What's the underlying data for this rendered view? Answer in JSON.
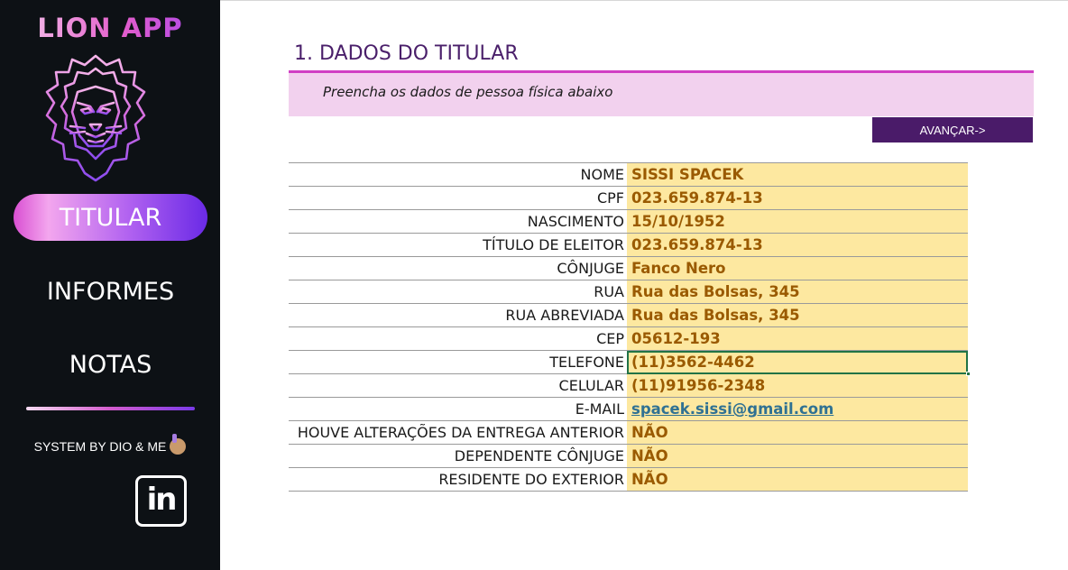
{
  "sidebar": {
    "app_title": "LION APP",
    "logo_icon": "lion-head-icon",
    "nav": [
      {
        "label": "TITULAR",
        "active": true
      },
      {
        "label": "INFORMES",
        "active": false
      },
      {
        "label": "NOTAS",
        "active": false
      }
    ],
    "credit": "SYSTEM BY DIO & ME",
    "credit_emoji": "person-raising-hand-icon",
    "social_icon": "linkedin-icon",
    "social_text": "in"
  },
  "main": {
    "section_title": "1. DADOS DO TITULAR",
    "instruction": "Preencha os dados de pessoa física abaixo",
    "advance_button": "AVANÇAR->",
    "fields": [
      {
        "label": "NOME",
        "value": "SISSI SPACEK"
      },
      {
        "label": "CPF",
        "value": "023.659.874-13"
      },
      {
        "label": "NASCIMENTO",
        "value": "15/10/1952"
      },
      {
        "label": "TÍTULO DE ELEITOR",
        "value": "023.659.874-13"
      },
      {
        "label": "CÔNJUGE",
        "value": "Fanco Nero"
      },
      {
        "label": "RUA",
        "value": "Rua das Bolsas, 345"
      },
      {
        "label": "RUA ABREVIADA",
        "value": "Rua das Bolsas, 345"
      },
      {
        "label": "CEP",
        "value": "05612-193"
      },
      {
        "label": "TELEFONE",
        "value": "(11)3562-4462"
      },
      {
        "label": "CELULAR",
        "value": "(11)91956-2348"
      },
      {
        "label": "E-MAIL",
        "value": "spacek.sissi@gmail.com"
      },
      {
        "label": "HOUVE ALTERAÇÕES DA ENTREGA ANTERIOR",
        "value": "NÃO"
      },
      {
        "label": "DEPENDENTE CÔNJUGE",
        "value": "NÃO"
      },
      {
        "label": "RESIDENTE DO EXTERIOR",
        "value": "NÃO"
      }
    ]
  },
  "colors": {
    "sidebar_bg": "#0d1115",
    "accent_purple": "#4a1b69",
    "accent_pink": "#d13fc4",
    "band_pink": "#f2d1ee",
    "input_yellow": "#fde8a0",
    "value_text": "#9a5a00",
    "selection_green": "#217346"
  }
}
